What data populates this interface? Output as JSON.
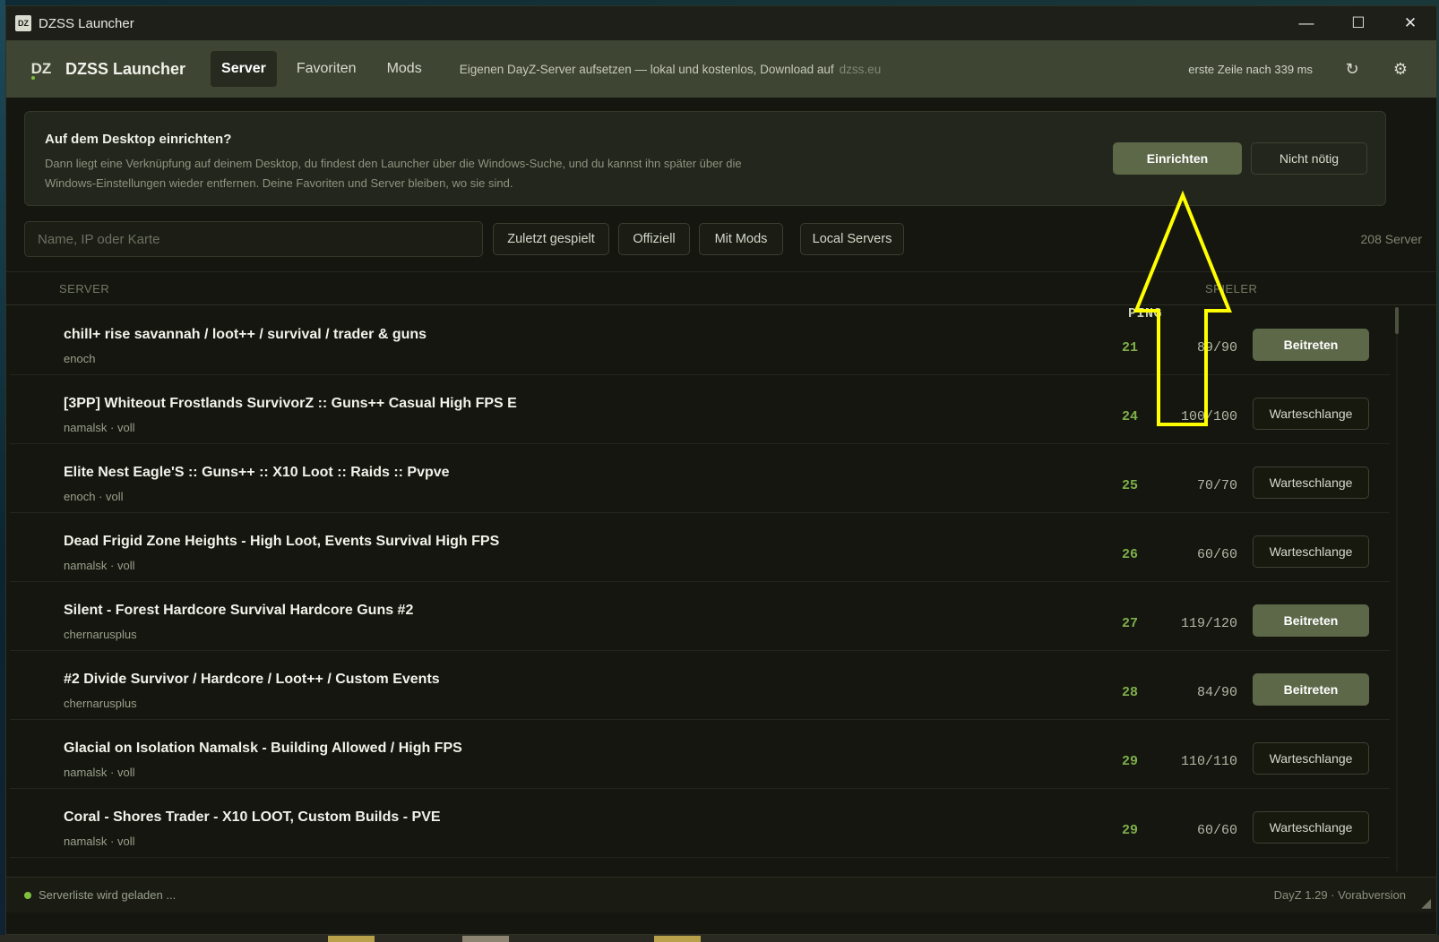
{
  "window": {
    "title": "DZSS Launcher",
    "logo_text": "DZ",
    "minimize": "—",
    "maximize": "☐",
    "close": "✕"
  },
  "header": {
    "logo_text": "DZ",
    "app_name": "DZSS Launcher",
    "tabs": [
      {
        "label": "Server"
      },
      {
        "label": "Favoriten"
      },
      {
        "label": "Mods"
      }
    ],
    "promo_text": "Eigenen DayZ-Server aufsetzen — lokal und kostenlos, Download auf",
    "promo_link": "dzss.eu",
    "load_time": "erste Zeile nach 339 ms",
    "refresh_icon": "↻",
    "settings_icon": "⚙"
  },
  "setup": {
    "title": "Auf dem Desktop einrichten?",
    "description": "Dann liegt eine Verknüpfung auf deinem Desktop, du findest den Launcher über die Windows-Suche, und du kannst ihn später über die Windows-Einstellungen wieder entfernen. Deine Favoriten und Server bleiben, wo sie sind.",
    "confirm_label": "Einrichten",
    "dismiss_label": "Nicht nötig"
  },
  "filters": {
    "search_placeholder": "Name, IP oder Karte",
    "chips": [
      "Zuletzt gespielt",
      "Offiziell",
      "Mit Mods",
      "Local Servers"
    ],
    "server_count": "208 Server"
  },
  "table": {
    "headers": {
      "server": "SERVER",
      "ping": "PING",
      "players": "SPIELER"
    },
    "rows": [
      {
        "name": "chill+ rise savannah / loot++ / survival / trader & guns",
        "sub": "enoch",
        "ping": "21",
        "players": "89/90",
        "action": "Beitreten",
        "action_type": "join"
      },
      {
        "name": "[3PP] Whiteout Frostlands SurvivorZ :: Guns++ Casual High FPS E",
        "sub": "namalsk · voll",
        "ping": "24",
        "players": "100/100",
        "action": "Warteschlange",
        "action_type": "queue"
      },
      {
        "name": "Elite Nest Eagle'S :: Guns++ :: X10 Loot :: Raids :: Pvpve",
        "sub": "enoch · voll",
        "ping": "25",
        "players": "70/70",
        "action": "Warteschlange",
        "action_type": "queue"
      },
      {
        "name": "Dead Frigid Zone Heights - High Loot, Events Survival High FPS",
        "sub": "namalsk · voll",
        "ping": "26",
        "players": "60/60",
        "action": "Warteschlange",
        "action_type": "queue"
      },
      {
        "name": "Silent - Forest Hardcore Survival Hardcore Guns #2",
        "sub": "chernarusplus",
        "ping": "27",
        "players": "119/120",
        "action": "Beitreten",
        "action_type": "join"
      },
      {
        "name": "#2 Divide Survivor / Hardcore / Loot++ / Custom Events",
        "sub": "chernarusplus",
        "ping": "28",
        "players": "84/90",
        "action": "Beitreten",
        "action_type": "join"
      },
      {
        "name": "Glacial on Isolation Namalsk - Building Allowed / High FPS",
        "sub": "namalsk · voll",
        "ping": "29",
        "players": "110/110",
        "action": "Warteschlange",
        "action_type": "queue"
      },
      {
        "name": "Coral - Shores Trader - X10 LOOT, Custom Builds - PVE",
        "sub": "namalsk · voll",
        "ping": "29",
        "players": "60/60",
        "action": "Warteschlange",
        "action_type": "queue"
      }
    ]
  },
  "footer": {
    "status": "Serverliste wird geladen ...",
    "version": "DayZ 1.29 · Vorabversion",
    "grip_icon": "◢"
  },
  "colors": {
    "accent": "#5c6848",
    "ping_green": "#7eb04a",
    "header_bg": "#3e4533",
    "annotation": "#ffff00"
  }
}
